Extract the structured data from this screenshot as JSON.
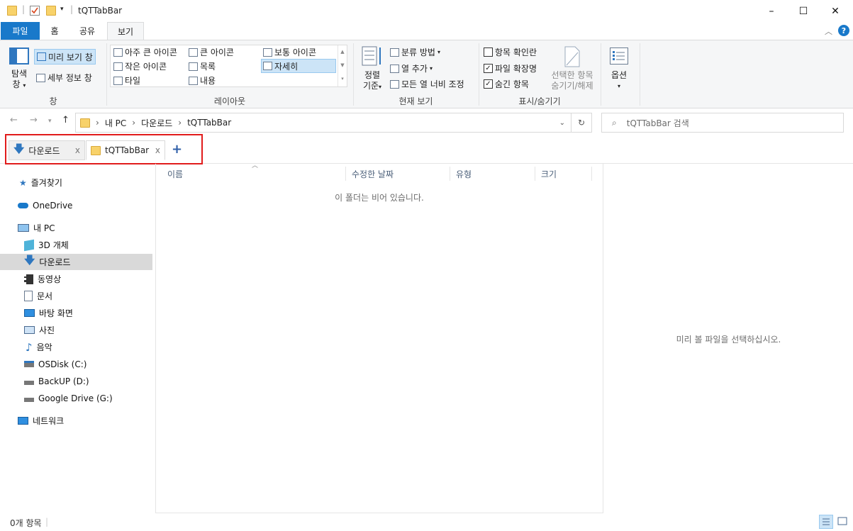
{
  "window": {
    "title": "tQTTabBar",
    "minimize": "–",
    "maximize": "☐",
    "close": "✕"
  },
  "ribbon_tabs": [
    "파일",
    "홈",
    "공유",
    "보기"
  ],
  "ribbon": {
    "pane_group": {
      "nav_pane_label": "탐색\n창",
      "nav_pane_line1": "탐색",
      "nav_pane_line2": "창",
      "preview_pane": "미리 보기 창",
      "details_pane": "세부 정보 창",
      "group_label": "창"
    },
    "layout_group": {
      "items": [
        "아주 큰 아이콘",
        "큰 아이콘",
        "보통 아이콘",
        "작은 아이콘",
        "목록",
        "자세히",
        "타일",
        "내용"
      ],
      "group_label": "레이아웃"
    },
    "current_view_group": {
      "sort_line1": "정렬",
      "sort_line2": "기준",
      "group_by": "분류 방법",
      "add_columns": "열 추가",
      "fit_columns": "모든 열 너비 조정",
      "group_label": "현재 보기"
    },
    "show_hide_group": {
      "item_checkboxes": "항목 확인란",
      "file_extensions": "파일 확장명",
      "hidden_items": "숨긴 항목",
      "hide_selected_line1": "선택한 항목",
      "hide_selected_line2": "숨기기/해제",
      "group_label": "표시/숨기기"
    },
    "options": "옵션"
  },
  "checkboxes": {
    "item_checkboxes": false,
    "file_extensions": true,
    "hidden_items": true
  },
  "address": {
    "path": [
      "내 PC",
      "다운로드",
      "tQTTabBar"
    ],
    "search_placeholder": "tQTTabBar 검색"
  },
  "tabs": [
    {
      "label": "다운로드",
      "close": "x"
    },
    {
      "label": "tQTTabBar",
      "close": "x"
    }
  ],
  "new_tab": "+",
  "nav_pane": [
    {
      "label": "즐겨찾기",
      "icon": "star-icon"
    },
    {
      "label": "OneDrive",
      "icon": "cloud-icon"
    },
    {
      "label": "내 PC",
      "icon": "computer-icon"
    },
    {
      "label": "3D 개체",
      "icon": "cube-icon"
    },
    {
      "label": "다운로드",
      "icon": "download-arrow-icon"
    },
    {
      "label": "동영상",
      "icon": "film-icon"
    },
    {
      "label": "문서",
      "icon": "document-icon"
    },
    {
      "label": "바탕 화면",
      "icon": "desktop-icon"
    },
    {
      "label": "사진",
      "icon": "picture-icon"
    },
    {
      "label": "음악",
      "icon": "music-note-icon"
    },
    {
      "label": "OSDisk (C:)",
      "icon": "drive-windows-icon"
    },
    {
      "label": "BackUP (D:)",
      "icon": "drive-icon"
    },
    {
      "label": "Google Drive (G:)",
      "icon": "drive-icon"
    },
    {
      "label": "네트워크",
      "icon": "network-icon"
    }
  ],
  "columns": [
    "이름",
    "수정한 날짜",
    "유형",
    "크기"
  ],
  "empty_message": "이 폴더는 비어 있습니다.",
  "preview_message": "미리 볼 파일을 선택하십시오.",
  "status": "0개 항목",
  "colors": {
    "accent": "#1979ca",
    "selection": "#d9d9d9",
    "highlight_box": "#e11c1c"
  }
}
